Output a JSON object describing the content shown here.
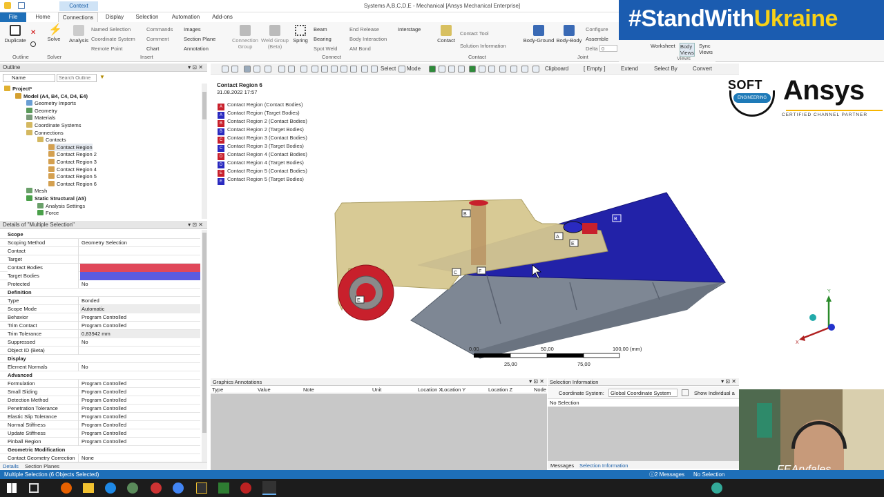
{
  "window": {
    "title": "Systems A,B,C,D,E - Mechanical [Ansys Mechanical Enterprise]",
    "context_tab": "Context"
  },
  "tabs": [
    "File",
    "Home",
    "Connections",
    "Display",
    "Selection",
    "Automation",
    "Add-ons"
  ],
  "ribbon": {
    "outline": {
      "duplicate": "Duplicate",
      "group": "Outline"
    },
    "solver": {
      "solve": "Solve",
      "group": "Solver"
    },
    "insert": {
      "analysis": "Analysis",
      "named_selection": "Named Selection",
      "coordinate_system": "Coordinate System",
      "remote_point": "Remote Point",
      "commands": "Commands",
      "comment": "Comment",
      "chart": "Chart",
      "images": "Images",
      "section_plane": "Section Plane",
      "annotation": "Annotation",
      "group": "Insert"
    },
    "connect": {
      "connection_group": "Connection Group",
      "weld_group": "Weld Group (Beta)",
      "spring": "Spring",
      "beam": "Beam",
      "bearing": "Bearing",
      "spot_weld": "Spot Weld",
      "end_release": "End Release",
      "body_interaction": "Body Interaction",
      "am_bond": "AM Bond",
      "interstage": "Interstage",
      "group": "Connect"
    },
    "contact": {
      "contact": "Contact",
      "contact_tool": "Contact Tool",
      "solution_information": "Solution Information",
      "group": "Contact"
    },
    "joint": {
      "body_ground": "Body-Ground",
      "body_body": "Body-Body",
      "configure": "Configure",
      "assemble": "Assemble",
      "delta": "Delta",
      "delta_value": "0",
      "group": "Joint"
    },
    "views": {
      "worksheet": "Worksheet",
      "body_views": "Body Views",
      "sync_views": "Sync Views",
      "group": "Views"
    }
  },
  "banner": {
    "hash": "#StandWith",
    "word": "Ukraine"
  },
  "toolbar": {
    "select": "Select",
    "mode": "Mode",
    "clipboard": "Clipboard",
    "empty": "[ Empty ]",
    "extend": "Extend",
    "select_by": "Select By",
    "convert": "Convert"
  },
  "outline": {
    "title": "Outline",
    "name_col": "Name",
    "search_placeholder": "Search Outline",
    "tree": [
      {
        "label": "Project*",
        "level": 0,
        "bold": true
      },
      {
        "label": "Model (A4, B4, C4, D4, E4)",
        "level": 1,
        "bold": true
      },
      {
        "label": "Geometry Imports",
        "level": 2
      },
      {
        "label": "Geometry",
        "level": 2
      },
      {
        "label": "Materials",
        "level": 2
      },
      {
        "label": "Coordinate Systems",
        "level": 2
      },
      {
        "label": "Connections",
        "level": 2
      },
      {
        "label": "Contacts",
        "level": 3
      },
      {
        "label": "Contact Region",
        "level": 4
      },
      {
        "label": "Contact Region 2",
        "level": 4
      },
      {
        "label": "Contact Region 3",
        "level": 4
      },
      {
        "label": "Contact Region 4",
        "level": 4
      },
      {
        "label": "Contact Region 5",
        "level": 4
      },
      {
        "label": "Contact Region 6",
        "level": 4
      },
      {
        "label": "Mesh",
        "level": 2
      },
      {
        "label": "Static Structural (A5)",
        "level": 2,
        "bold": true
      },
      {
        "label": "Analysis Settings",
        "level": 3
      },
      {
        "label": "Force",
        "level": 3
      }
    ]
  },
  "details": {
    "title": "Details of \"Multiple Selection\"",
    "rows": [
      {
        "section": "Scope"
      },
      {
        "k": "Scoping Method",
        "v": "Geometry Selection"
      },
      {
        "k": "Contact",
        "v": ""
      },
      {
        "k": "Target",
        "v": ""
      },
      {
        "k": "Contact Bodies",
        "v": "",
        "color": "#e0485a"
      },
      {
        "k": "Target Bodies",
        "v": "",
        "color": "#5b5be0"
      },
      {
        "k": "Protected",
        "v": "No"
      },
      {
        "section": "Definition"
      },
      {
        "k": "Type",
        "v": "Bonded"
      },
      {
        "k": "Scope Mode",
        "v": "Automatic"
      },
      {
        "k": "Behavior",
        "v": "Program Controlled"
      },
      {
        "k": "Trim Contact",
        "v": "Program Controlled"
      },
      {
        "k": "Trim Tolerance",
        "v": "0,83942 mm"
      },
      {
        "k": "Suppressed",
        "v": "No"
      },
      {
        "k": "Object ID (Beta)",
        "v": ""
      },
      {
        "section": "Display"
      },
      {
        "k": "Element Normals",
        "v": "No"
      },
      {
        "section": "Advanced"
      },
      {
        "k": "Formulation",
        "v": "Program Controlled"
      },
      {
        "k": "Small Sliding",
        "v": "Program Controlled"
      },
      {
        "k": "Detection Method",
        "v": "Program Controlled"
      },
      {
        "k": "Penetration Tolerance",
        "v": "Program Controlled"
      },
      {
        "k": "Elastic Slip Tolerance",
        "v": "Program Controlled"
      },
      {
        "k": "Normal Stiffness",
        "v": "Program Controlled"
      },
      {
        "k": "Update Stiffness",
        "v": "Program Controlled"
      },
      {
        "k": "Pinball Region",
        "v": "Program Controlled"
      },
      {
        "section": "Geometric Modification"
      },
      {
        "k": "Contact Geometry Correction",
        "v": "None"
      }
    ]
  },
  "bottom_tabs": [
    "Details",
    "Section Planes"
  ],
  "viewport": {
    "title": "Contact Region 6",
    "date": "31.08.2022 17:57",
    "legend": [
      {
        "tag": "A",
        "label": "Contact Region (Contact Bodies)",
        "color": "#c8202c"
      },
      {
        "tag": "A",
        "label": "Contact Region (Target Bodies)",
        "color": "#2a2ac0"
      },
      {
        "tag": "B",
        "label": "Contact Region 2 (Contact Bodies)",
        "color": "#c8202c"
      },
      {
        "tag": "B",
        "label": "Contact Region 2 (Target Bodies)",
        "color": "#2a2ac0"
      },
      {
        "tag": "C",
        "label": "Contact Region 3 (Contact Bodies)",
        "color": "#c8202c"
      },
      {
        "tag": "C",
        "label": "Contact Region 3 (Target Bodies)",
        "color": "#2a2ac0"
      },
      {
        "tag": "D",
        "label": "Contact Region 4 (Contact Bodies)",
        "color": "#c8202c"
      },
      {
        "tag": "D",
        "label": "Contact Region 4 (Target Bodies)",
        "color": "#2a2ac0"
      },
      {
        "tag": "E",
        "label": "Contact Region 5 (Contact Bodies)",
        "color": "#c8202c"
      },
      {
        "tag": "E",
        "label": "Contact Region 5 (Target Bodies)",
        "color": "#2a2ac0"
      }
    ],
    "scale": {
      "labels_top": [
        "0,00",
        "50,00",
        "100,00 (mm)"
      ],
      "labels_bottom": [
        "25,00",
        "75,00"
      ]
    },
    "axes": {
      "x": "X",
      "y": "Y"
    }
  },
  "brand": {
    "soft": "SOFT",
    "engineering": "ENGINEERING",
    "ansys": "Ansys",
    "tagline": "CERTIFIED CHANNEL PARTNER"
  },
  "annotations": {
    "title": "Graphics Annotations",
    "columns": [
      "Type",
      "Value",
      "Note",
      "Unit",
      "Location X",
      "Location Y",
      "Location Z",
      "Node"
    ]
  },
  "selection_info": {
    "title": "Selection Information",
    "cs_label": "Coordinate System:",
    "cs_value": "Global Coordinate System",
    "show_individual": "Show Individual a",
    "no_selection": "No Selection",
    "tabs": [
      "Messages",
      "Selection Information"
    ]
  },
  "status": {
    "left": "Multiple Selection (6 Objects Selected)",
    "messages": "2 Messages",
    "selection": "No Selection"
  },
  "webcam": {
    "caption": "FEAryfales"
  }
}
